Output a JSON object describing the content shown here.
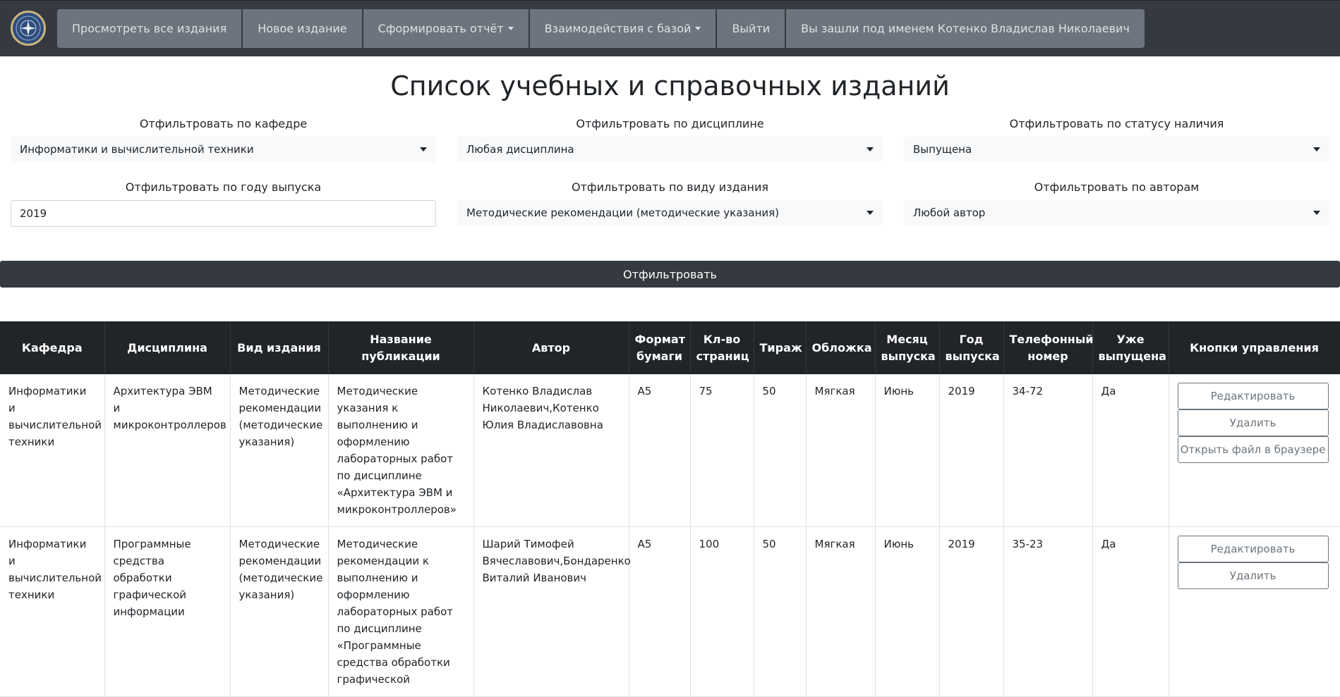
{
  "nav": {
    "items": [
      {
        "label": "Просмотреть все издания",
        "dropdown": false
      },
      {
        "label": "Новое издание",
        "dropdown": false
      },
      {
        "label": "Сформировать отчёт",
        "dropdown": true
      },
      {
        "label": "Взаимодействия с базой",
        "dropdown": true
      },
      {
        "label": "Выйти",
        "dropdown": false
      },
      {
        "label": "Вы зашли под именем Котенко Владислав Николаевич",
        "dropdown": false
      }
    ]
  },
  "page": {
    "title": "Список учебных и справочных изданий"
  },
  "filters": {
    "department": {
      "label": "Отфильтровать по кафедре",
      "value": "Информатики и вычислительной техники"
    },
    "discipline": {
      "label": "Отфильтровать по дисциплине",
      "value": "Любая дисциплина"
    },
    "status": {
      "label": "Отфильтровать по статусу наличия",
      "value": "Выпущена"
    },
    "year": {
      "label": "Отфильтровать по году выпуска",
      "value": "2019"
    },
    "type": {
      "label": "Отфильтровать по виду издания",
      "value": "Методические рекомендации (методические указания)"
    },
    "authors": {
      "label": "Отфильтровать по авторам",
      "value": "Любой автор"
    },
    "submit_label": "Отфильтровать"
  },
  "table": {
    "headers": [
      "Кафедра",
      "Дисциплина",
      "Вид издания",
      "Название публикации",
      "Автор",
      "Формат бумаги",
      "Кл-во страниц",
      "Тираж",
      "Обложка",
      "Месяц выпуска",
      "Год выпуска",
      "Телефонный номер",
      "Уже выпущена",
      "Кнопки управления"
    ],
    "rows": [
      {
        "cells": [
          "Информатики и вычислительной техники",
          "Архитектура ЭВМ и микроконтроллеров",
          "Методические рекомендации (методические указания)",
          "Методические указания к выполнению и оформлению лабораторных работ по дисциплине «Архитектура ЭВМ и микроконтроллеров»",
          "Котенко Владислав Николаевич,Котенко Юлия Владиславовна",
          "A5",
          "75",
          "50",
          "Мягкая",
          "Июнь",
          "2019",
          "34-72",
          "Да"
        ],
        "actions": {
          "edit": "Редактировать",
          "delete": "Удалить",
          "open": "Открыть файл в браузере"
        }
      },
      {
        "cells": [
          "Информатики и вычислительной техники",
          "Программные средства обработки графической информации",
          "Методические рекомендации (методические указания)",
          "Методические рекомендации к выполнению и оформлению лабораторных работ по дисциплине «Программные средства обработки графической",
          "Шарий Тимофей Вячеславович,Бондаренко Виталий Иванович",
          "A5",
          "100",
          "50",
          "Мягкая",
          "Июнь",
          "2019",
          "35-23",
          "Да"
        ],
        "actions": {
          "edit": "Редактировать",
          "delete": "Удалить"
        }
      }
    ]
  },
  "colors": {
    "navbar": "#343a40",
    "nav_item": "#6c757d",
    "table_header": "#212529",
    "button_dark": "#343a40"
  }
}
